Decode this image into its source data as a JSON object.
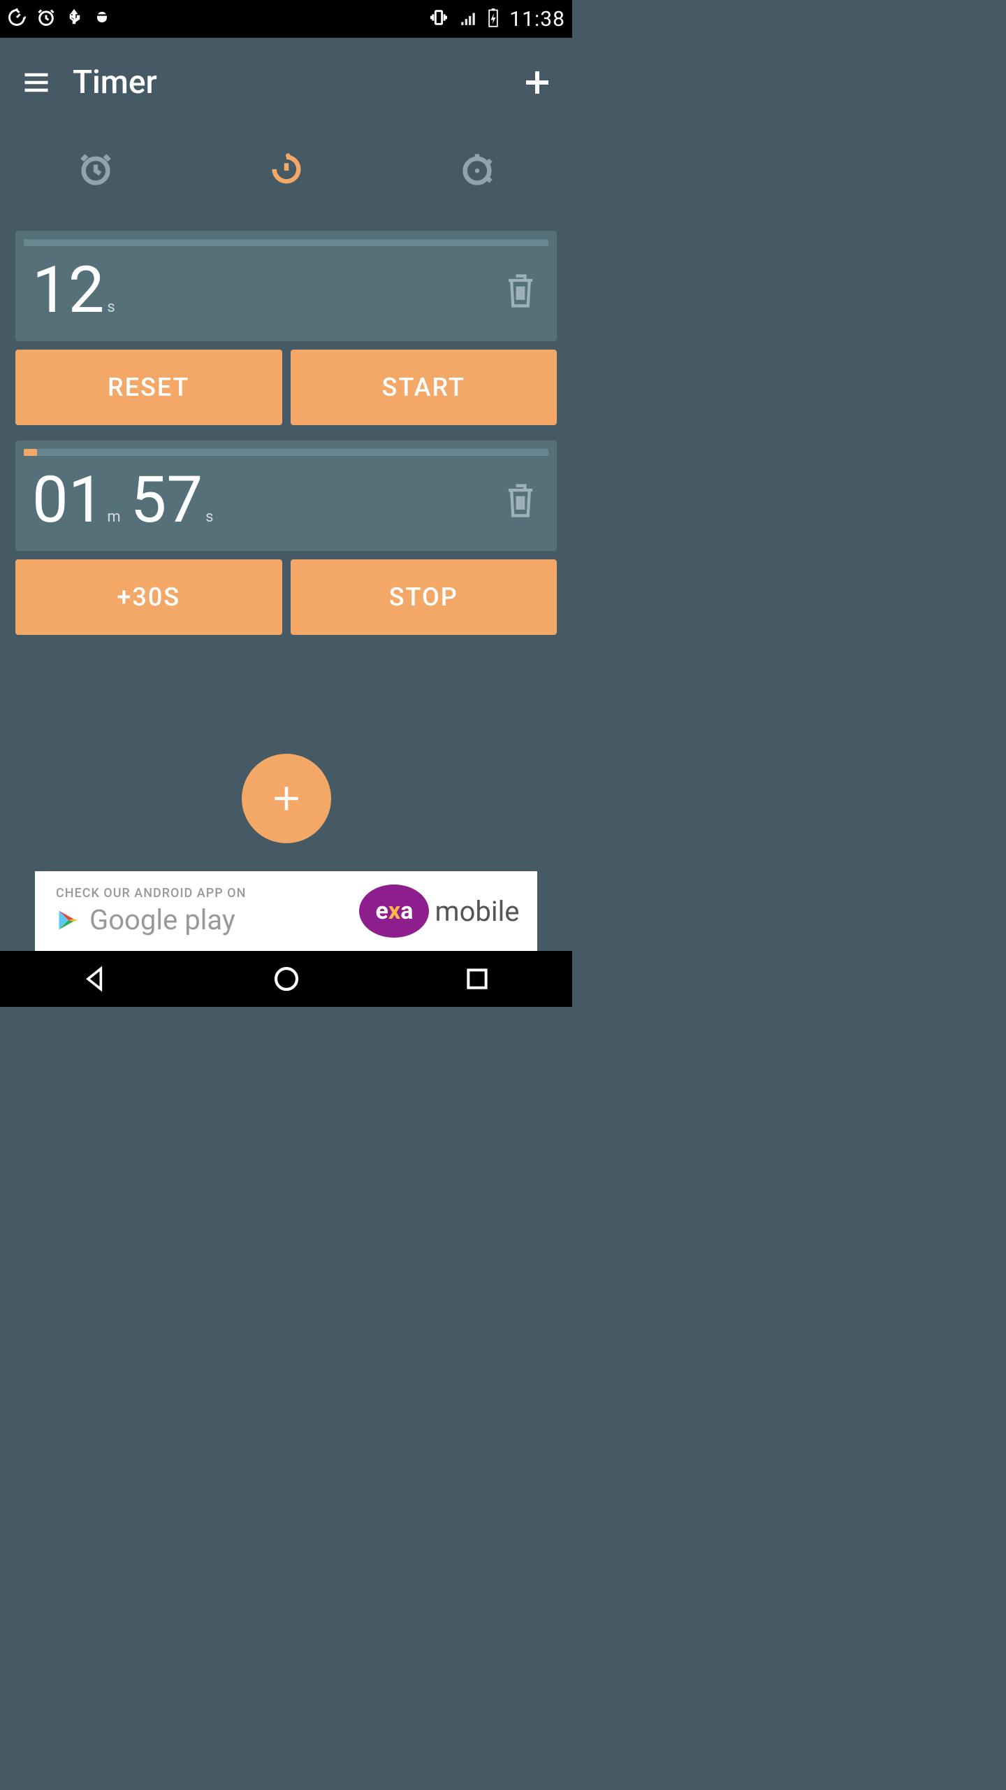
{
  "status": {
    "time": "11:38"
  },
  "header": {
    "title": "Timer"
  },
  "tabs": {
    "active": "timer"
  },
  "timers": [
    {
      "progress_pct": 0,
      "min": null,
      "sec": "12",
      "unit_s": "s",
      "btn_left": "RESET",
      "btn_right": "START"
    },
    {
      "progress_pct": 2.5,
      "min": "01",
      "unit_m": "m",
      "sec": "57",
      "unit_s": "s",
      "btn_left": "+30S",
      "btn_right": "STOP"
    }
  ],
  "ad": {
    "check_line": "CHECK OUR ANDROID APP ON",
    "gp_text": "Google play",
    "exa_e": "e",
    "exa_x": "x",
    "exa_a": "a",
    "mobile": "mobile"
  }
}
